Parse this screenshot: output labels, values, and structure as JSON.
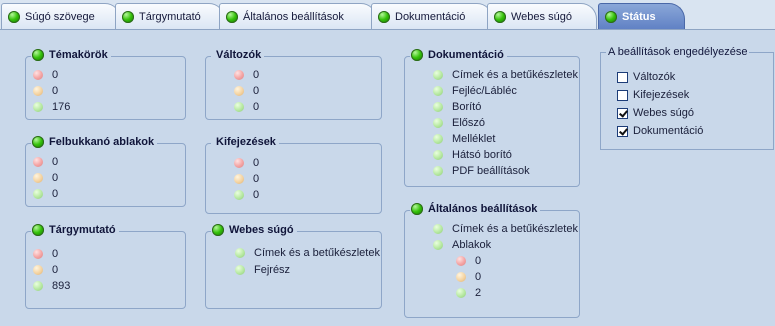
{
  "tabs": [
    {
      "label": "Súgó szövege",
      "active": false
    },
    {
      "label": "Tárgymutató",
      "active": false
    },
    {
      "label": "Általános beállítások",
      "active": false
    },
    {
      "label": "Dokumentáció",
      "active": false
    },
    {
      "label": "Webes súgó",
      "active": false
    },
    {
      "label": "Státus",
      "active": true
    }
  ],
  "groups": {
    "temakorok": {
      "title": "Témakörök",
      "values": [
        "0",
        "0",
        "176"
      ]
    },
    "felbukkano": {
      "title": "Felbukkanó ablakok",
      "values": [
        "0",
        "0",
        "0"
      ]
    },
    "targymutato": {
      "title": "Tárgymutató",
      "values": [
        "0",
        "0",
        "893"
      ]
    },
    "valtozok": {
      "title": "Változók",
      "values": [
        "0",
        "0",
        "0"
      ]
    },
    "kifejezesek": {
      "title": "Kifejezések",
      "values": [
        "0",
        "0",
        "0"
      ]
    },
    "webes_sugo": {
      "title": "Webes súgó",
      "items": [
        "Címek és a betűkészletek",
        "Fejrész"
      ]
    },
    "dokumentacio": {
      "title": "Dokumentáció",
      "items": [
        "Címek és a betűkészletek",
        "Fejléc/Lábléc",
        "Borító",
        "Előszó",
        "Melléklet",
        "Hátsó borító",
        "PDF beállítások"
      ]
    },
    "altalanos": {
      "title": "Általános beállítások",
      "items": [
        "Címek és a betűkészletek",
        "Ablakok"
      ],
      "ablakok_values": [
        "0",
        "0",
        "2"
      ]
    }
  },
  "settings": {
    "title": "A beállítások engedélyezése",
    "options": [
      {
        "label": "Változók",
        "checked": false
      },
      {
        "label": "Kifejezések",
        "checked": false
      },
      {
        "label": "Webes súgó",
        "checked": true
      },
      {
        "label": "Dokumentáció",
        "checked": true
      }
    ]
  }
}
